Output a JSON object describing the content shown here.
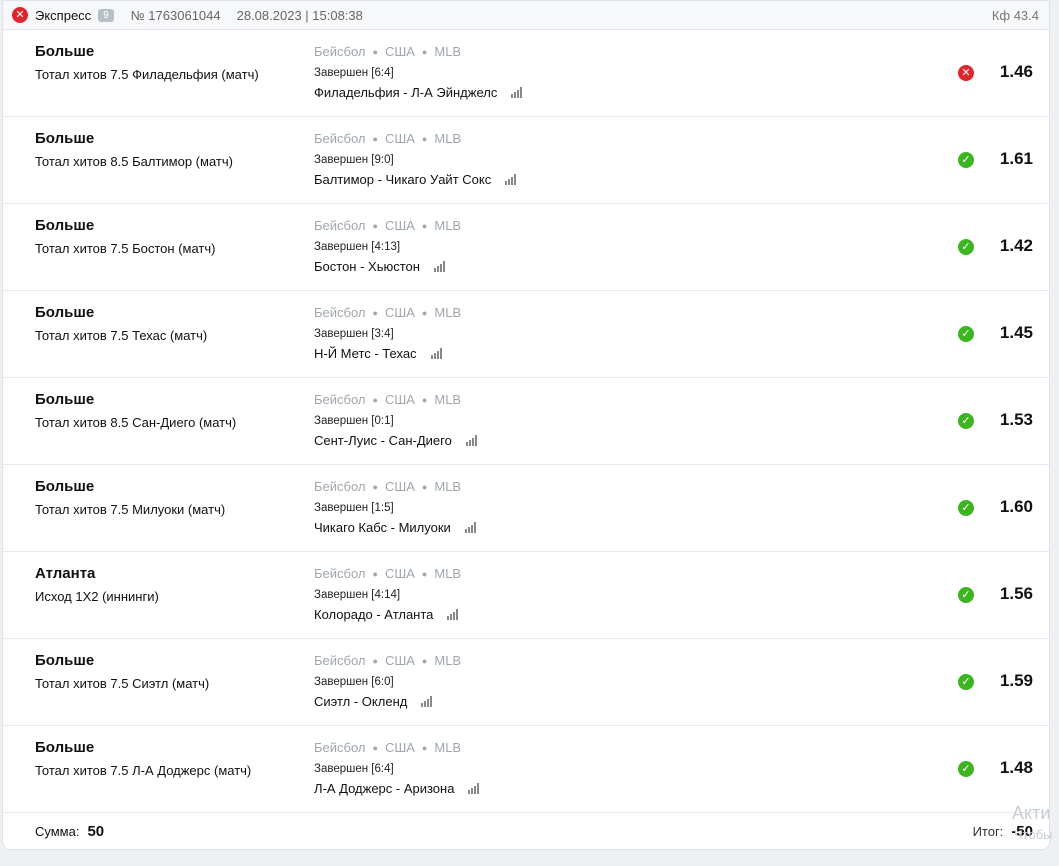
{
  "header": {
    "type": "Экспресс",
    "count": "9",
    "number": "№ 1763061044",
    "datetime": "28.08.2023 | 15:08:38",
    "coef": "Кф 43.4"
  },
  "colors": {
    "win": "#3cb521",
    "loss": "#e0262c"
  },
  "rows": [
    {
      "pick": "Больше",
      "market": "Тотал хитов 7.5 Филадельфия (матч)",
      "sport": "Бейсбол",
      "country": "США",
      "league": "MLB",
      "status": "Завершен [6:4]",
      "teams": "Филадельфия - Л-А Эйнджелс",
      "result": "loss",
      "odds": "1.46"
    },
    {
      "pick": "Больше",
      "market": "Тотал хитов 8.5 Балтимор (матч)",
      "sport": "Бейсбол",
      "country": "США",
      "league": "MLB",
      "status": "Завершен [9:0]",
      "teams": "Балтимор - Чикаго Уайт Сокс",
      "result": "win",
      "odds": "1.61"
    },
    {
      "pick": "Больше",
      "market": "Тотал хитов 7.5 Бостон (матч)",
      "sport": "Бейсбол",
      "country": "США",
      "league": "MLB",
      "status": "Завершен [4:13]",
      "teams": "Бостон - Хьюстон",
      "result": "win",
      "odds": "1.42"
    },
    {
      "pick": "Больше",
      "market": "Тотал хитов 7.5 Техас (матч)",
      "sport": "Бейсбол",
      "country": "США",
      "league": "MLB",
      "status": "Завершен [3:4]",
      "teams": "Н-Й Метс - Техас",
      "result": "win",
      "odds": "1.45"
    },
    {
      "pick": "Больше",
      "market": "Тотал хитов 8.5 Сан-Диего (матч)",
      "sport": "Бейсбол",
      "country": "США",
      "league": "MLB",
      "status": "Завершен [0:1]",
      "teams": "Сент-Луис - Сан-Диего",
      "result": "win",
      "odds": "1.53"
    },
    {
      "pick": "Больше",
      "market": "Тотал хитов 7.5 Милуоки (матч)",
      "sport": "Бейсбол",
      "country": "США",
      "league": "MLB",
      "status": "Завершен [1:5]",
      "teams": "Чикаго Кабс - Милуоки",
      "result": "win",
      "odds": "1.60"
    },
    {
      "pick": "Атланта",
      "market": "Исход 1X2 (иннинги)",
      "sport": "Бейсбол",
      "country": "США",
      "league": "MLB",
      "status": "Завершен [4:14]",
      "teams": "Колорадо - Атланта",
      "result": "win",
      "odds": "1.56"
    },
    {
      "pick": "Больше",
      "market": "Тотал хитов 7.5 Сиэтл (матч)",
      "sport": "Бейсбол",
      "country": "США",
      "league": "MLB",
      "status": "Завершен [6:0]",
      "teams": "Сиэтл - Окленд",
      "result": "win",
      "odds": "1.59"
    },
    {
      "pick": "Больше",
      "market": "Тотал хитов 7.5 Л-А Доджерс (матч)",
      "sport": "Бейсбол",
      "country": "США",
      "league": "MLB",
      "status": "Завершен [6:4]",
      "teams": "Л-А Доджерс - Аризона",
      "result": "win",
      "odds": "1.48"
    }
  ],
  "footer": {
    "sum_label": "Сумма:",
    "sum_value": "50",
    "total_label": "Итог:",
    "total_value": "-50"
  },
  "watermark": {
    "line1": "Акти",
    "line2": "Чтобы"
  }
}
